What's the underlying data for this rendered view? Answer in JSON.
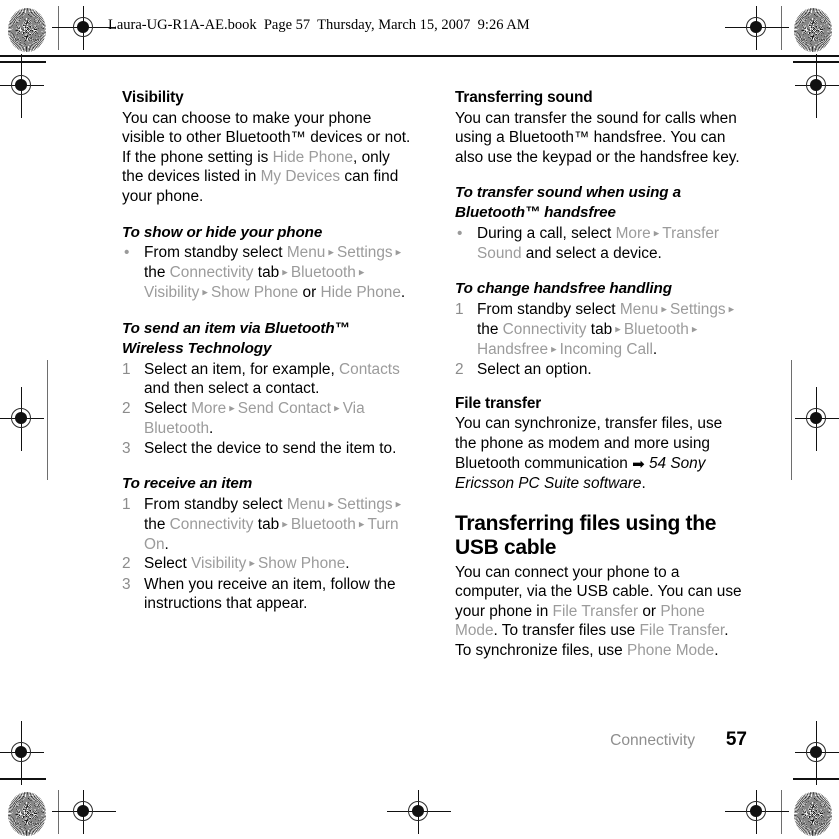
{
  "header": {
    "file_line": "Laura-UG-R1A-AE.book  Page 57  Thursday, March 15, 2007  9:26 AM"
  },
  "footer": {
    "chapter": "Connectivity",
    "page_number": "57"
  },
  "colors": {
    "ui_text_grey": "#9b9b9b",
    "body_text": "#000000",
    "marker_grey": "#8c8c8c",
    "footer_chapter_grey": "#8e8e8e"
  },
  "left_column": {
    "heading": "Visibility",
    "intro_parts": [
      {
        "t": "You can choose to make your phone visible to other Bluetooth™ devices or not. If the phone setting is ",
        "s": "plain"
      },
      {
        "t": "Hide Phone",
        "s": "ui"
      },
      {
        "t": ", only the devices listed in ",
        "s": "plain"
      },
      {
        "t": "My Devices",
        "s": "ui"
      },
      {
        "t": " can find your phone.",
        "s": "plain"
      }
    ],
    "proc1": {
      "title": "To show or hide your phone",
      "bullets": [
        [
          {
            "t": "From standby select ",
            "s": "plain"
          },
          {
            "t": "Menu",
            "s": "ui"
          },
          {
            "t": " ▸ ",
            "s": "arrow"
          },
          {
            "t": "Settings",
            "s": "ui"
          },
          {
            "t": " ▸ ",
            "s": "arrow"
          },
          {
            "t": "the ",
            "s": "plain"
          },
          {
            "t": "Connectivity",
            "s": "ui"
          },
          {
            "t": " tab",
            "s": "plain"
          },
          {
            "t": " ▸ ",
            "s": "arrow"
          },
          {
            "t": "Bluetooth",
            "s": "ui"
          },
          {
            "t": " ▸ ",
            "s": "arrow"
          },
          {
            "t": "Visibility",
            "s": "ui"
          },
          {
            "t": " ▸ ",
            "s": "arrow"
          },
          {
            "t": "Show Phone",
            "s": "ui"
          },
          {
            "t": " or ",
            "s": "plain"
          },
          {
            "t": "Hide Phone",
            "s": "ui"
          },
          {
            "t": ".",
            "s": "plain"
          }
        ]
      ]
    },
    "proc2": {
      "title": "To send an item via Bluetooth™ Wireless Technology",
      "steps": [
        {
          "num": "1",
          "parts": [
            {
              "t": "Select an item, for example, ",
              "s": "plain"
            },
            {
              "t": "Contacts",
              "s": "ui"
            },
            {
              "t": " and then select a contact.",
              "s": "plain"
            }
          ]
        },
        {
          "num": "2",
          "parts": [
            {
              "t": "Select ",
              "s": "plain"
            },
            {
              "t": "More",
              "s": "ui"
            },
            {
              "t": " ▸ ",
              "s": "arrow"
            },
            {
              "t": "Send Contact",
              "s": "ui"
            },
            {
              "t": " ▸ ",
              "s": "arrow"
            },
            {
              "t": "Via Bluetooth",
              "s": "ui"
            },
            {
              "t": ".",
              "s": "plain"
            }
          ]
        },
        {
          "num": "3",
          "parts": [
            {
              "t": "Select the device to send the item to.",
              "s": "plain"
            }
          ]
        }
      ]
    },
    "proc3": {
      "title": "To receive an item",
      "steps": [
        {
          "num": "1",
          "parts": [
            {
              "t": "From standby select ",
              "s": "plain"
            },
            {
              "t": "Menu",
              "s": "ui"
            },
            {
              "t": " ▸ ",
              "s": "arrow"
            },
            {
              "t": "Settings",
              "s": "ui"
            },
            {
              "t": " ▸ ",
              "s": "arrow"
            },
            {
              "t": "the ",
              "s": "plain"
            },
            {
              "t": "Connectivity",
              "s": "ui"
            },
            {
              "t": " tab",
              "s": "plain"
            },
            {
              "t": " ▸ ",
              "s": "arrow"
            },
            {
              "t": "Bluetooth",
              "s": "ui"
            },
            {
              "t": " ▸ ",
              "s": "arrow"
            },
            {
              "t": "Turn On",
              "s": "ui"
            },
            {
              "t": ".",
              "s": "plain"
            }
          ]
        },
        {
          "num": "2",
          "parts": [
            {
              "t": "Select ",
              "s": "plain"
            },
            {
              "t": "Visibility",
              "s": "ui"
            },
            {
              "t": " ▸ ",
              "s": "arrow"
            },
            {
              "t": "Show Phone",
              "s": "ui"
            },
            {
              "t": ".",
              "s": "plain"
            }
          ]
        },
        {
          "num": "3",
          "parts": [
            {
              "t": "When you receive an item, follow the instructions that appear.",
              "s": "plain"
            }
          ]
        }
      ]
    }
  },
  "right_column": {
    "heading": "Transferring sound",
    "intro_parts": [
      {
        "t": "You can transfer the sound for calls when using a Bluetooth™ handsfree. You can also use the keypad or the handsfree key.",
        "s": "plain"
      }
    ],
    "proc1": {
      "title": "To transfer sound when using a Bluetooth™ handsfree",
      "bullets": [
        [
          {
            "t": "During a call, select ",
            "s": "plain"
          },
          {
            "t": "More",
            "s": "ui"
          },
          {
            "t": " ▸ ",
            "s": "arrow"
          },
          {
            "t": "Transfer Sound",
            "s": "ui"
          },
          {
            "t": " and select a device.",
            "s": "plain"
          }
        ]
      ]
    },
    "proc2": {
      "title": "To change handsfree handling",
      "steps": [
        {
          "num": "1",
          "parts": [
            {
              "t": "From standby select ",
              "s": "plain"
            },
            {
              "t": "Menu",
              "s": "ui"
            },
            {
              "t": " ▸ ",
              "s": "arrow"
            },
            {
              "t": "Settings",
              "s": "ui"
            },
            {
              "t": " ▸ ",
              "s": "arrow"
            },
            {
              "t": "the ",
              "s": "plain"
            },
            {
              "t": "Connectivity",
              "s": "ui"
            },
            {
              "t": " tab",
              "s": "plain"
            },
            {
              "t": " ▸ ",
              "s": "arrow"
            },
            {
              "t": "Bluetooth",
              "s": "ui"
            },
            {
              "t": " ▸ ",
              "s": "arrow"
            },
            {
              "t": "Handsfree",
              "s": "ui"
            },
            {
              "t": " ▸ ",
              "s": "arrow"
            },
            {
              "t": "Incoming Call",
              "s": "ui"
            },
            {
              "t": ".",
              "s": "plain"
            }
          ]
        },
        {
          "num": "2",
          "parts": [
            {
              "t": "Select an option.",
              "s": "plain"
            }
          ]
        }
      ]
    },
    "subheading2": "File transfer",
    "file_transfer_parts": [
      {
        "t": "You can synchronize, transfer files, use the phone as modem and more using Bluetooth communication ",
        "s": "plain"
      },
      {
        "t": "➡",
        "s": "xref-arrow"
      },
      {
        "t": " 54 Sony Ericsson PC Suite software",
        "s": "italic"
      },
      {
        "t": ".",
        "s": "plain"
      }
    ],
    "section_heading": "Transferring files using the USB cable",
    "usb_parts": [
      {
        "t": "You can connect your phone to a computer, via the USB cable. You can use your phone in ",
        "s": "plain"
      },
      {
        "t": "File Transfer",
        "s": "ui"
      },
      {
        "t": " or ",
        "s": "plain"
      },
      {
        "t": "Phone Mode",
        "s": "ui"
      },
      {
        "t": ". To transfer files use ",
        "s": "plain"
      },
      {
        "t": "File Transfer",
        "s": "ui"
      },
      {
        "t": ". To synchronize files, use ",
        "s": "plain"
      },
      {
        "t": "Phone Mode",
        "s": "ui"
      },
      {
        "t": ".",
        "s": "plain"
      }
    ]
  }
}
